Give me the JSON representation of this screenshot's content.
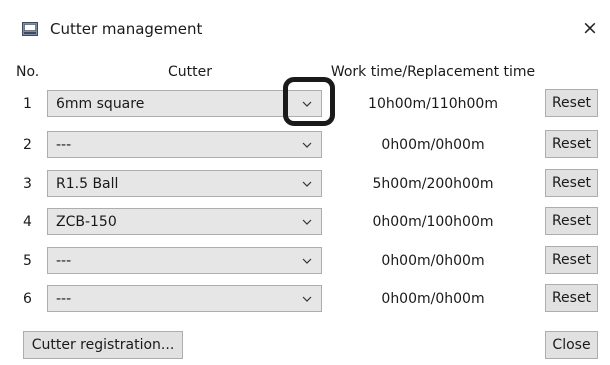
{
  "window": {
    "title": "Cutter management",
    "app_icon": "monitor-icon",
    "close_symbol": "×"
  },
  "table": {
    "headers": {
      "no": "No.",
      "cutter": "Cutter",
      "time": "Work time/Replacement time"
    },
    "rows": [
      {
        "no": "1",
        "cutter": "6mm square",
        "time": "10h00m/110h00m",
        "reset": "Reset"
      },
      {
        "no": "2",
        "cutter": "---",
        "time": "0h00m/0h00m",
        "reset": "Reset"
      },
      {
        "no": "3",
        "cutter": "R1.5 Ball",
        "time": "5h00m/200h00m",
        "reset": "Reset"
      },
      {
        "no": "4",
        "cutter": "ZCB-150",
        "time": "0h00m/100h00m",
        "reset": "Reset"
      },
      {
        "no": "5",
        "cutter": "---",
        "time": "0h00m/0h00m",
        "reset": "Reset"
      },
      {
        "no": "6",
        "cutter": "---",
        "time": "0h00m/0h00m",
        "reset": "Reset"
      }
    ]
  },
  "footer": {
    "register_label": "Cutter registration...",
    "close_label": "Close"
  },
  "colors": {
    "select_bg": "#e6e6e6",
    "button_bg": "#e1e1e1",
    "border": "#adadad",
    "highlight": "#1a1a1a"
  }
}
